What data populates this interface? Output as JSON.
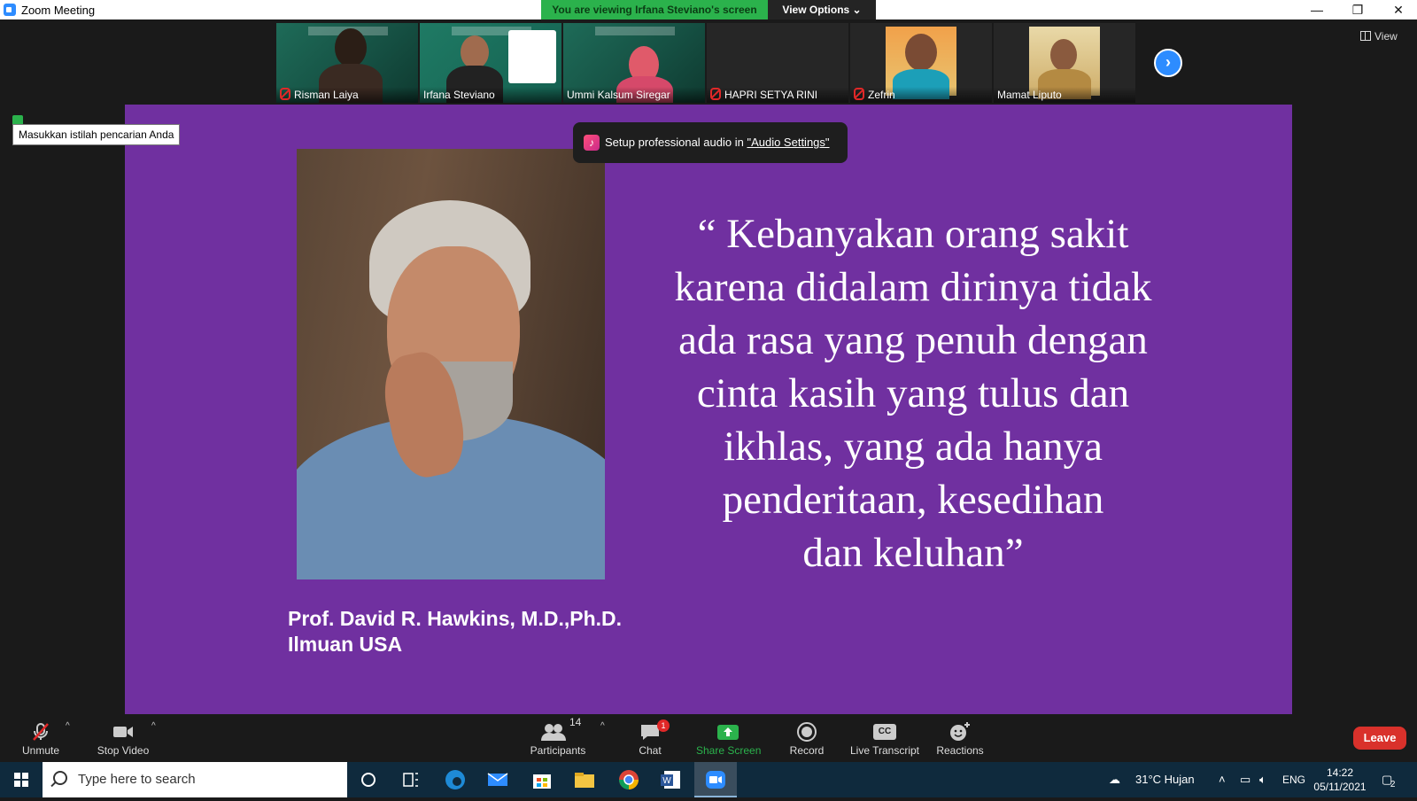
{
  "window": {
    "title": "Zoom Meeting",
    "minimize": "—",
    "restore": "❐",
    "close": "✕"
  },
  "banner": {
    "viewing_text": "You are viewing Irfana Steviano's screen",
    "view_options": "View Options ⌄"
  },
  "top_view_label": "View",
  "participants_strip": [
    {
      "name": "Risman Laiya",
      "muted": true
    },
    {
      "name": "Irfana Steviano",
      "muted": false,
      "active": true
    },
    {
      "name": "Ummi Kalsum Siregar",
      "muted": false
    },
    {
      "name": "HAPRI SETYA RINI",
      "muted": true
    },
    {
      "name": "Zefrin",
      "muted": true
    },
    {
      "name": "Mamat Liputo",
      "muted": false
    }
  ],
  "search_tooltip": "Masukkan istilah pencarian Anda",
  "audio_toast": {
    "prefix": "Setup professional audio in ",
    "link": "\"Audio Settings\""
  },
  "slide": {
    "background": "#7030a0",
    "caption_line1": "Prof. David R. Hawkins, M.D.,Ph.D.",
    "caption_line2": "Ilmuan USA",
    "quote_lines": [
      "“ Kebanyakan orang sakit",
      "karena didalam dirinya tidak",
      "ada rasa yang penuh dengan",
      "cinta kasih yang tulus dan",
      "ikhlas, yang ada hanya",
      "penderitaan, kesedihan",
      "dan keluhan”"
    ]
  },
  "toolbar": {
    "unmute": "Unmute",
    "stop_video": "Stop Video",
    "participants": "Participants",
    "participants_count": "14",
    "chat": "Chat",
    "chat_badge": "1",
    "share_screen": "Share Screen",
    "record": "Record",
    "live_transcript": "Live Transcript",
    "reactions": "Reactions",
    "leave": "Leave",
    "cc_icon_text": "CC"
  },
  "taskbar": {
    "search_placeholder": "Type here to search",
    "weather": "31°C  Hujan",
    "language": "ENG",
    "time": "14:22",
    "date": "05/11/2021",
    "notifications": "2"
  },
  "colors": {
    "accent_blue": "#2d8cff",
    "banner_green": "#2bb24c",
    "leave_red": "#d9312b",
    "slide_purple": "#7030a0"
  }
}
